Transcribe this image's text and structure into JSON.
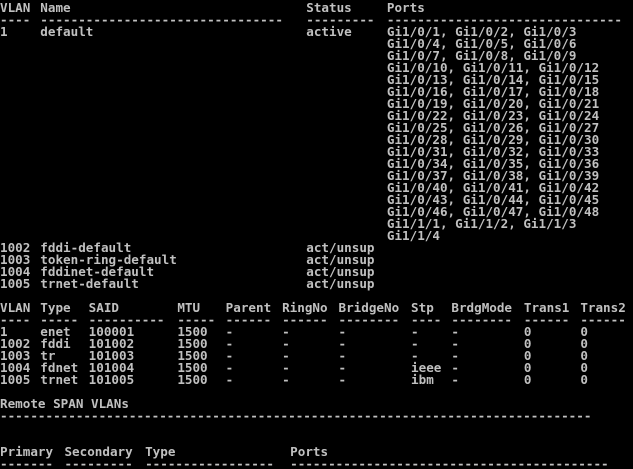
{
  "colors": {
    "background": "#000000",
    "foreground": "#c0c0c0"
  },
  "vlan_brief": {
    "headers": {
      "vlan": "VLAN",
      "name": "Name",
      "status": "Status",
      "ports": "Ports"
    },
    "rows": [
      {
        "vlan": "1",
        "name": "default",
        "status": "active",
        "ports": [
          "Gi1/0/1, Gi1/0/2, Gi1/0/3",
          "Gi1/0/4, Gi1/0/5, Gi1/0/6",
          "Gi1/0/7, Gi1/0/8, Gi1/0/9",
          "Gi1/0/10, Gi1/0/11, Gi1/0/12",
          "Gi1/0/13, Gi1/0/14, Gi1/0/15",
          "Gi1/0/16, Gi1/0/17, Gi1/0/18",
          "Gi1/0/19, Gi1/0/20, Gi1/0/21",
          "Gi1/0/22, Gi1/0/23, Gi1/0/24",
          "Gi1/0/25, Gi1/0/26, Gi1/0/27",
          "Gi1/0/28, Gi1/0/29, Gi1/0/30",
          "Gi1/0/31, Gi1/0/32, Gi1/0/33",
          "Gi1/0/34, Gi1/0/35, Gi1/0/36",
          "Gi1/0/37, Gi1/0/38, Gi1/0/39",
          "Gi1/0/40, Gi1/0/41, Gi1/0/42",
          "Gi1/0/43, Gi1/0/44, Gi1/0/45",
          "Gi1/0/46, Gi1/0/47, Gi1/0/48",
          "Gi1/1/1, Gi1/1/2, Gi1/1/3",
          "Gi1/1/4"
        ]
      },
      {
        "vlan": "1002",
        "name": "fddi-default",
        "status": "act/unsup",
        "ports": []
      },
      {
        "vlan": "1003",
        "name": "token-ring-default",
        "status": "act/unsup",
        "ports": []
      },
      {
        "vlan": "1004",
        "name": "fddinet-default",
        "status": "act/unsup",
        "ports": []
      },
      {
        "vlan": "1005",
        "name": "trnet-default",
        "status": "act/unsup",
        "ports": []
      }
    ]
  },
  "vlan_detail": {
    "headers": {
      "vlan": "VLAN",
      "type": "Type",
      "said": "SAID",
      "mtu": "MTU",
      "parent": "Parent",
      "ringno": "RingNo",
      "bridgeno": "BridgeNo",
      "stp": "Stp",
      "brdgmode": "BrdgMode",
      "trans1": "Trans1",
      "trans2": "Trans2"
    },
    "rows": [
      {
        "vlan": "1",
        "type": "enet",
        "said": "100001",
        "mtu": "1500",
        "parent": "-",
        "ringno": "-",
        "bridgeno": "-",
        "stp": "-",
        "brdgmode": "-",
        "trans1": "0",
        "trans2": "0"
      },
      {
        "vlan": "1002",
        "type": "fddi",
        "said": "101002",
        "mtu": "1500",
        "parent": "-",
        "ringno": "-",
        "bridgeno": "-",
        "stp": "-",
        "brdgmode": "-",
        "trans1": "0",
        "trans2": "0"
      },
      {
        "vlan": "1003",
        "type": "tr",
        "said": "101003",
        "mtu": "1500",
        "parent": "-",
        "ringno": "-",
        "bridgeno": "-",
        "stp": "-",
        "brdgmode": "-",
        "trans1": "0",
        "trans2": "0"
      },
      {
        "vlan": "1004",
        "type": "fdnet",
        "said": "101004",
        "mtu": "1500",
        "parent": "-",
        "ringno": "-",
        "bridgeno": "-",
        "stp": "ieee",
        "brdgmode": "-",
        "trans1": "0",
        "trans2": "0"
      },
      {
        "vlan": "1005",
        "type": "trnet",
        "said": "101005",
        "mtu": "1500",
        "parent": "-",
        "ringno": "-",
        "bridgeno": "-",
        "stp": "ibm",
        "brdgmode": "-",
        "trans1": "0",
        "trans2": "0"
      }
    ]
  },
  "remote_span": {
    "title": "Remote SPAN VLANs"
  },
  "private_vlans": {
    "headers": {
      "primary": "Primary",
      "secondary": "Secondary",
      "type": "Type",
      "ports": "Ports"
    }
  }
}
